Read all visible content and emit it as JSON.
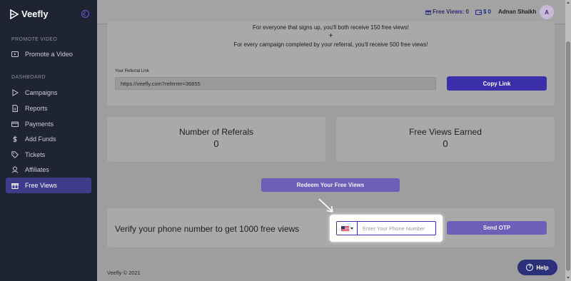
{
  "brand": {
    "name": "Veefly"
  },
  "sidebar": {
    "section_promote": "PROMOTE VIDEO",
    "promote_item": {
      "label": "Promote a Video",
      "icon": "video-icon"
    },
    "section_dashboard": "DASHBOARD",
    "items": [
      {
        "label": "Campaigns",
        "icon": "play-icon"
      },
      {
        "label": "Reports",
        "icon": "document-icon"
      },
      {
        "label": "Payments",
        "icon": "credit-card-icon"
      },
      {
        "label": "Add Funds",
        "icon": "dollar-icon"
      },
      {
        "label": "Tickets",
        "icon": "tag-icon"
      },
      {
        "label": "Affiliates",
        "icon": "user-icon"
      },
      {
        "label": "Free Views",
        "icon": "gift-icon",
        "active": true
      }
    ]
  },
  "topbar": {
    "free_views": "Free Views: 0",
    "balance": "$ 0",
    "user_name": "Adnan Shaikh",
    "avatar_initial": "A"
  },
  "referral": {
    "line1": "For everyone that signs up, you'll both receive 150 free views!",
    "plus": "+",
    "line2": "For every campaign completed by your referral, you'll receive 500 free views!",
    "link_label": "Your Referral Link",
    "link_value": "https://veefly.com?referrer=36855",
    "copy_button": "Copy Link"
  },
  "stats": {
    "referrals_title": "Number of Referals",
    "referrals_value": "0",
    "earned_title": "Free Views Earned",
    "earned_value": "0"
  },
  "redeem_button": "Redeem Your Free Views",
  "verify": {
    "text": "Verify your phone number to get 1000 free views",
    "phone_placeholder": "Enter Your Phone Number",
    "send_button": "Send OTP"
  },
  "footer": {
    "text": "Veefly © 2021"
  },
  "help_button": "Help",
  "colors": {
    "accent": "#3a2fa8",
    "sidebar_bg": "#1f2433",
    "active_item": "#3d3a8a"
  }
}
